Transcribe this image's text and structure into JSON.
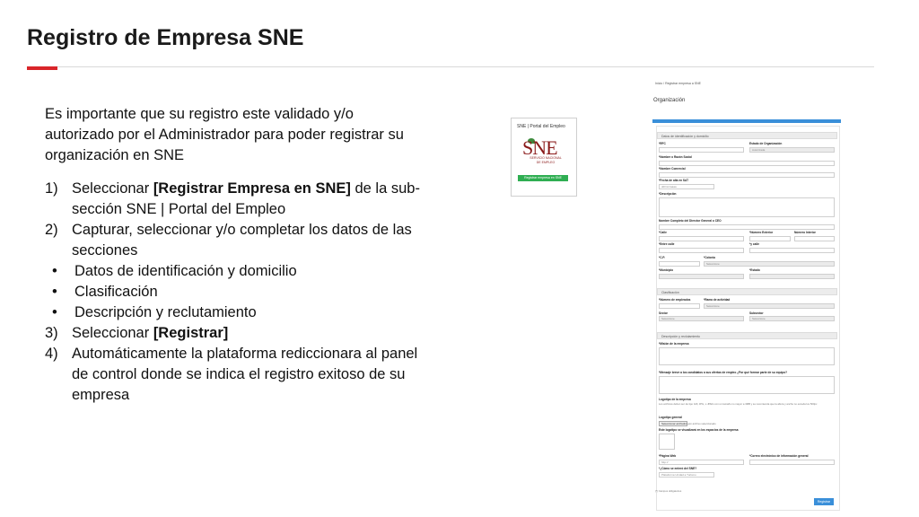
{
  "slide": {
    "title": "Registro de Empresa SNE",
    "intro": "Es importante que su registro este validado y/o autorizado por el Administrador para poder registrar su organización en SNE",
    "steps": [
      {
        "num": "1)",
        "pre": "Seleccionar ",
        "bold": "[Registrar Empresa en SNE]",
        "post": " de la sub-sección  SNE | Portal del Empleo"
      },
      {
        "num": "2)",
        "pre": "Capturar, seleccionar  y/o completar los datos de las secciones",
        "bold": "",
        "post": ""
      },
      {
        "num": "3)",
        "pre": "Seleccionar ",
        "bold": "[Registrar]",
        "post": ""
      },
      {
        "num": "4)",
        "pre": "Automáticamente la plataforma rediccionara al panel de control donde se indica el registro exitoso de su  empresa",
        "bold": "",
        "post": ""
      }
    ],
    "bullets": [
      "Datos de identificación y domicilio",
      "Clasificación",
      "Descripción y reclutamiento"
    ],
    "bullet_glyph": "•"
  },
  "sne_card": {
    "title": "SNE | Portal del Empleo",
    "logo": "SNE",
    "logo_sub": "SERVICIO NACIONAL",
    "logo_sub2": "DE EMPLEO",
    "button": "Registrar empresa en SNE"
  },
  "form": {
    "breadcrumb": "Inicio / Registrar empresa a SNE",
    "heading": "Organización",
    "sections": {
      "identificacion": "Datos de identificación y domicilio",
      "clasificacion": "Clasificación",
      "descripcion": "Descripción y reclutamiento"
    },
    "labels": {
      "rfc": "*RFC",
      "estado_org": "Estado de Organización",
      "razon_social": "*Nombre o Razón Social",
      "nombre_comercial": "*Nombre Comercial",
      "fecha_alta": "*Fecha de alta en SAT",
      "descripcion": "*Descripción",
      "director": "Nombre Completo del Director General o CEO",
      "calle": "*Calle",
      "num_exterior": "*Número Exterior",
      "num_interior": "Número Interior",
      "entre_calle": "*Entre calle",
      "y_calle": "*y calle",
      "cp": "*C.P.",
      "colonia": "*Colonia",
      "municipio": "*Municipio",
      "estado": "*Estado",
      "num_empleados": "*Número de empleados",
      "rama": "*Rama de actividad",
      "sector": "Sector",
      "subsector": "Subsector",
      "mision": "*Misión de la empresa",
      "mensaje": "*Mensaje breve a los candidatos a sus ofertas de empleo ¿Por qué formar parte de su equipo?",
      "logotipo": "Logotipo de la empresa",
      "logotipo_general": "Logotipo general",
      "logos_visual": "Este logotipo se visualizará en los espacios de la empresa",
      "pagina_web": "*Página Web",
      "correo": "*Correo electrónico de información general",
      "como_entero": "*¿Cómo se enteró del SNE?"
    },
    "values": {
      "estado_org": "Autorizada",
      "fecha_alta": "dd/mm/aaaa",
      "seleccione": "Seleccione",
      "pagina_placeholder": "http://",
      "como_entero_value": "Plataforma Unidad a Turismo",
      "file_button": "Seleccionar archivo",
      "file_status": "Ningún archivo seleccionado"
    },
    "logo_note": "Los archivos deben ser de tipo GIF, JPG, o JPEG con un tamaño no mayor a 3MB y se recomienda que la altura y ancho no exceda los 500px",
    "required_note": "(*) Campos obligatorios",
    "submit": "Registrar"
  },
  "colors": {
    "accent_red": "#d9252a",
    "form_blue": "#3a8fd9",
    "card_green": "#2fae52"
  }
}
